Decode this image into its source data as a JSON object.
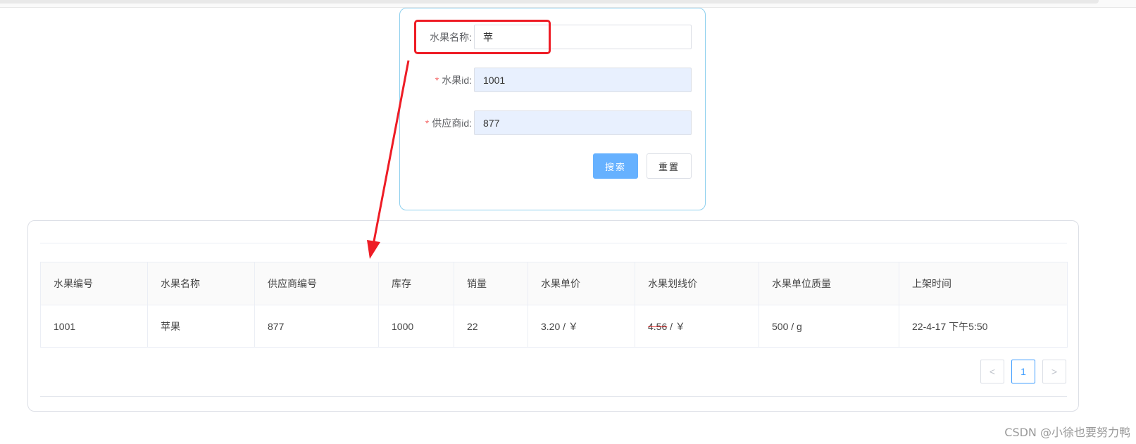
{
  "form": {
    "fruit_name": {
      "label": "水果名称:",
      "value": "苹"
    },
    "fruit_id": {
      "label": "水果id:",
      "value": "1001",
      "required_mark": "*"
    },
    "supplier_id": {
      "label": "供应商id:",
      "value": "877",
      "required_mark": "*"
    },
    "search_button": "搜索",
    "reset_button": "重置"
  },
  "table": {
    "columns": [
      "水果编号",
      "水果名称",
      "供应商编号",
      "库存",
      "销量",
      "水果单价",
      "水果划线价",
      "水果单位质量",
      "上架时间"
    ],
    "rows": [
      {
        "fruit_no": "1001",
        "fruit_name": "苹果",
        "supplier_no": "877",
        "stock": "1000",
        "sales": "22",
        "unit_price": "3.20 / ￥",
        "strike_price": "4.56",
        "strike_price_unit": " / ￥",
        "unit_weight": "500 / g",
        "listed_time": "22-4-17 下午5:50"
      }
    ]
  },
  "pagination": {
    "prev": "<",
    "current_page": "1",
    "next": ">"
  },
  "annotation": {
    "highlight_color": "#ee1c25"
  },
  "watermark": "CSDN @小徐也要努力鸭"
}
